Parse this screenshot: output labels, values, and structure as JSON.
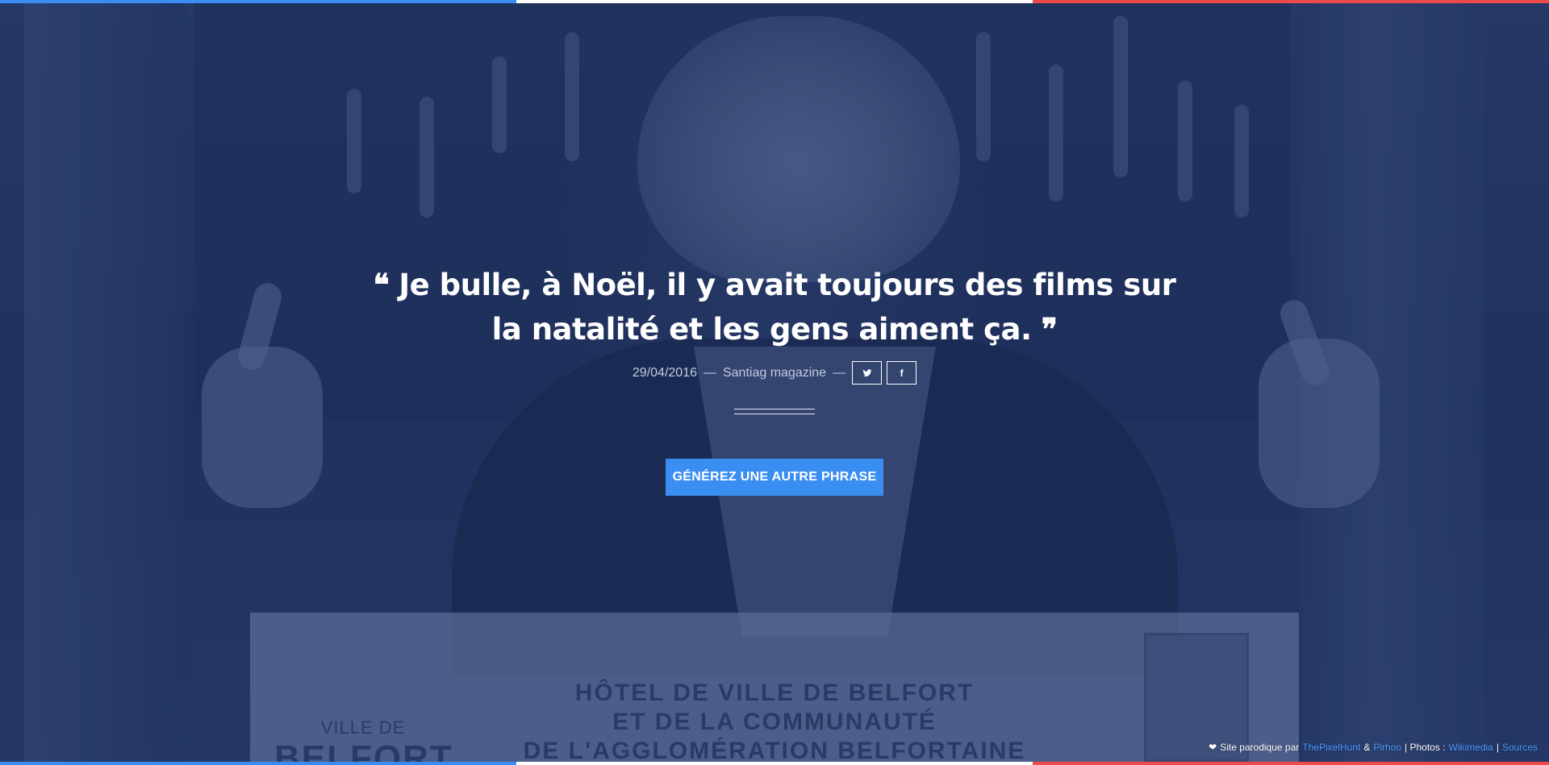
{
  "colors": {
    "tricolor_blue": "#3a8ef2",
    "tricolor_white": "#ffffff",
    "tricolor_red": "#ef4a4a",
    "accent_button": "#3a8ef2",
    "link": "#4a9bff"
  },
  "quote": {
    "open_mark": "❝",
    "line1": "Je bulle, à Noël, il y avait toujours des films sur",
    "line2": "la natalité et les gens aiment ça.",
    "close_mark": "❞"
  },
  "meta": {
    "date": "29/04/2016",
    "dash1": "—",
    "source": "Santiag magazine",
    "dash2": "—"
  },
  "share": {
    "twitter_icon": "twitter-icon",
    "facebook_icon": "facebook-icon",
    "facebook_glyph": "f"
  },
  "generate_button": {
    "label": "GÉNÉREZ UNE AUTRE PHRASE"
  },
  "footer": {
    "heart": "❤",
    "prefix": "Site parodique par",
    "link1": "ThePixelHunt",
    "amp": "&",
    "link2": "Pirhoo",
    "photos_label": "| Photos :",
    "link3": "Wikimedia",
    "pipe": "|",
    "link4": "Sources"
  },
  "photo": {
    "podium_line1": "HÔTEL DE VILLE DE BELFORT",
    "podium_line2": "ET DE LA COMMUNAUTÉ",
    "podium_line3": "DE L'AGGLOMÉRATION BELFORTAINE",
    "logo_small": "VILLE DE",
    "logo_big": "BELFORT"
  }
}
